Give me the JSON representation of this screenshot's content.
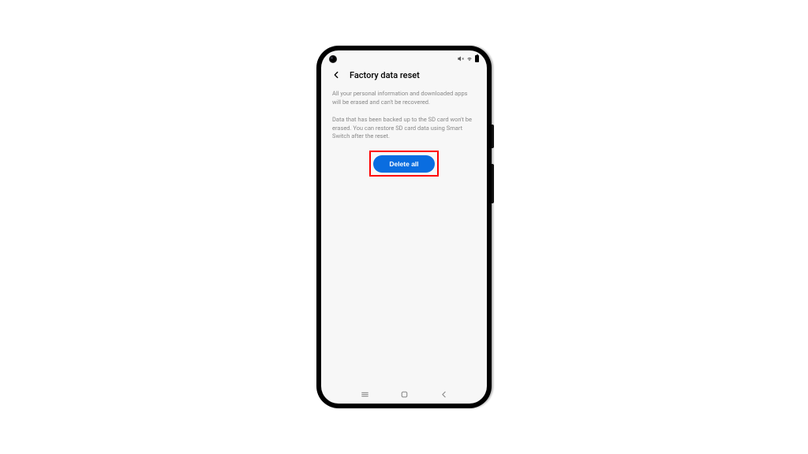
{
  "header": {
    "title": "Factory data reset"
  },
  "content": {
    "paragraph1": "All your personal information and downloaded apps will be erased and can't be recovered.",
    "paragraph2": "Data that has been backed up to the SD card won't be erased. You can restore SD card data using Smart Switch after the reset.",
    "primary_button_label": "Delete all"
  },
  "colors": {
    "primary": "#0a6de0",
    "highlight": "#ff0000"
  }
}
